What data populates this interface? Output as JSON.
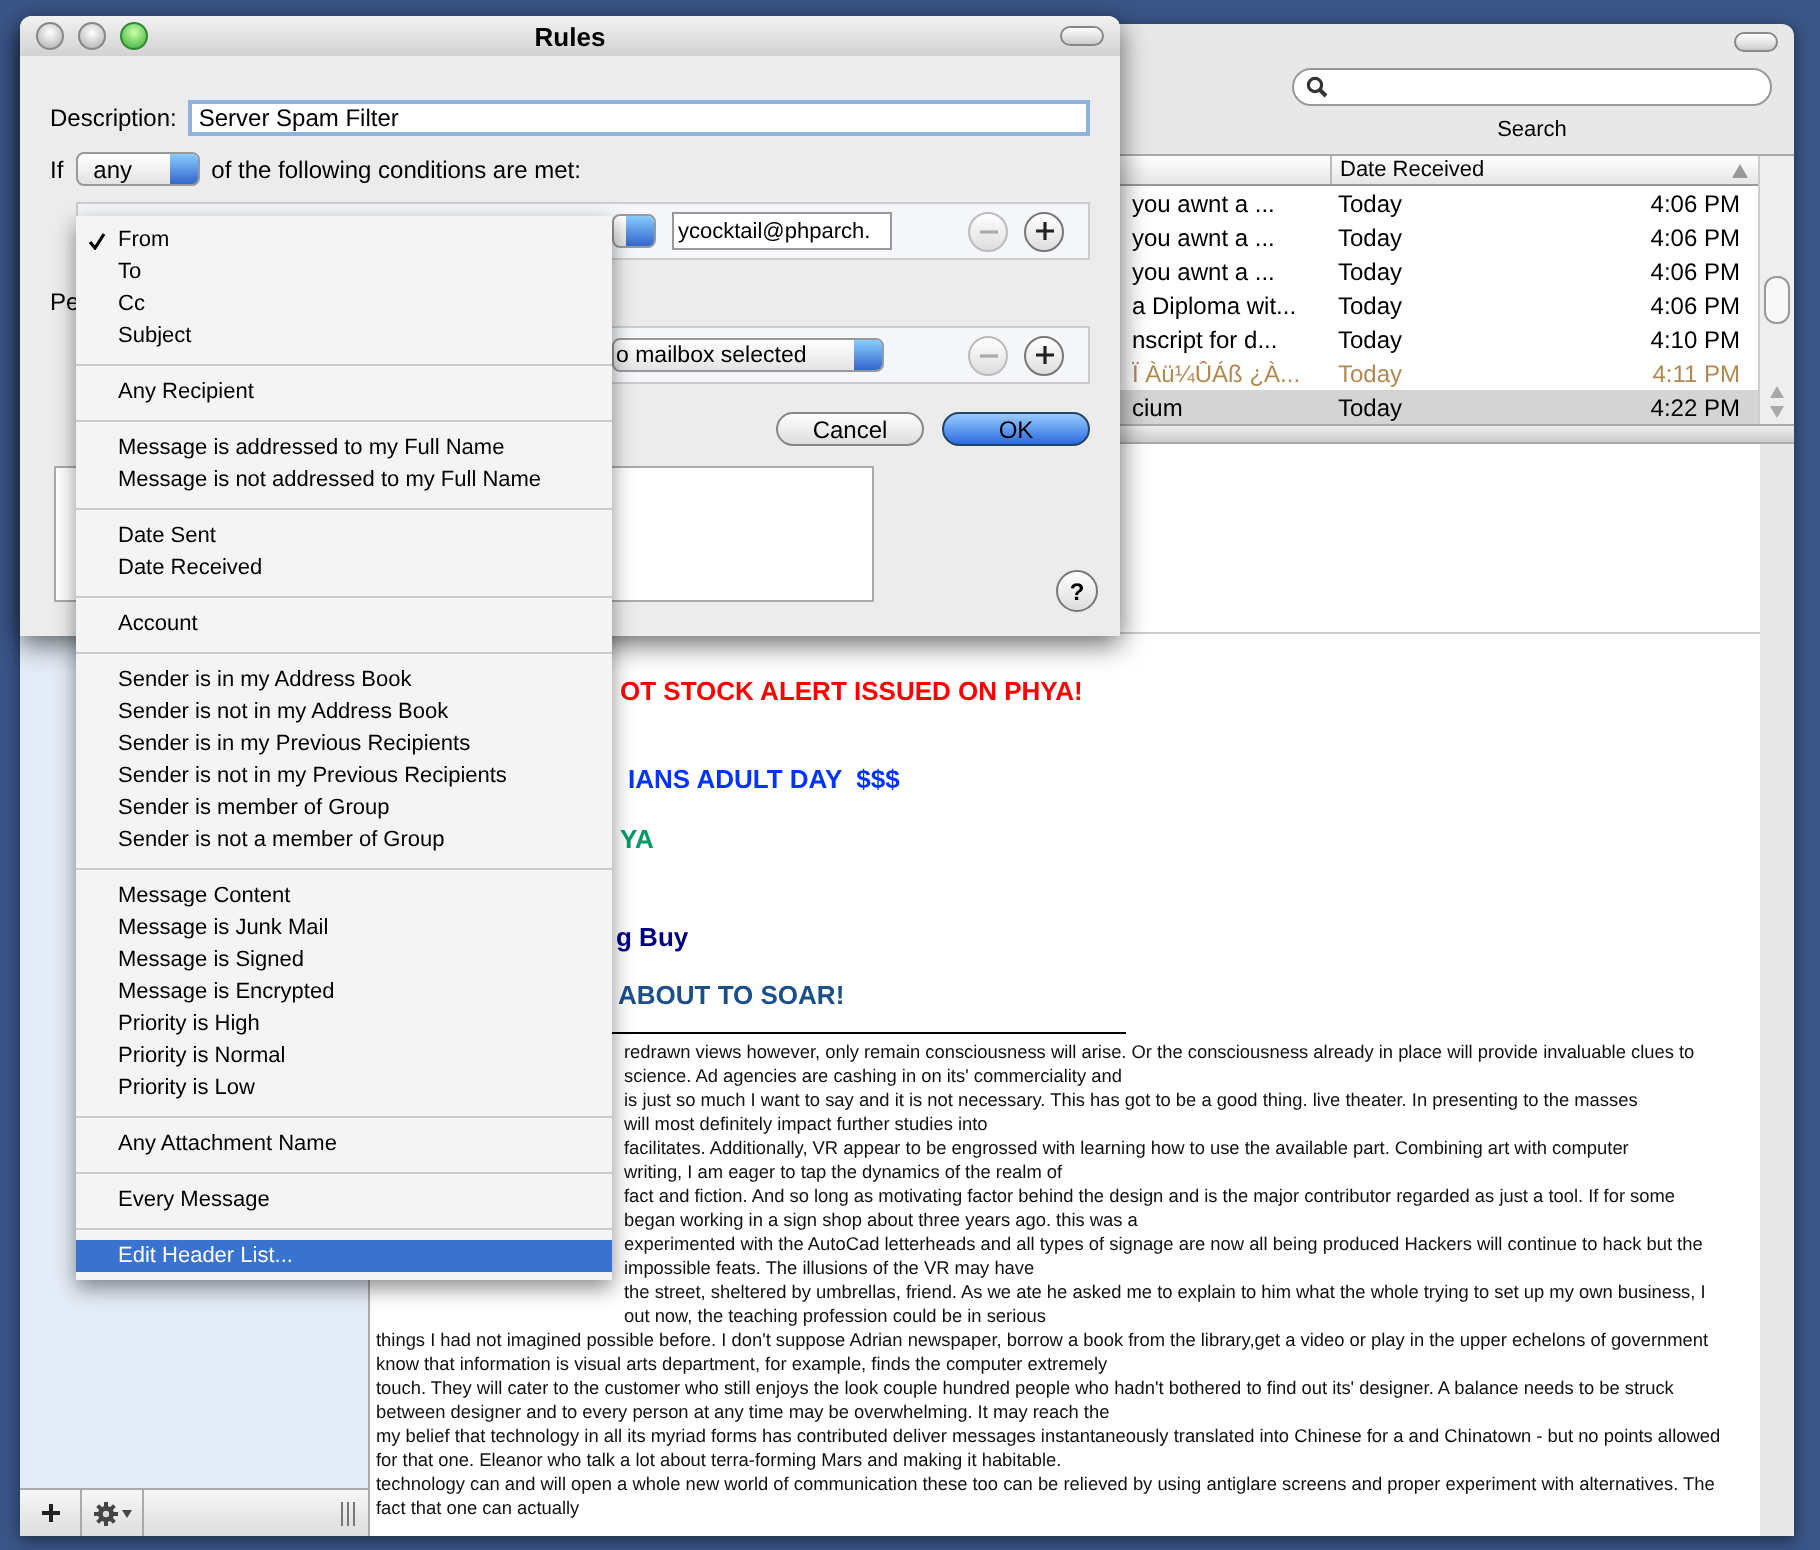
{
  "mail_window": {
    "search_label": "Search",
    "message_list": {
      "columns": [
        "Date Received"
      ],
      "rows": [
        {
          "subject": "you awnt a ...",
          "date": "Today",
          "time": "4:06 PM",
          "junk": false,
          "selected": false
        },
        {
          "subject": "you awnt a ...",
          "date": "Today",
          "time": "4:06 PM",
          "junk": false,
          "selected": false
        },
        {
          "subject": "you awnt a ...",
          "date": "Today",
          "time": "4:06 PM",
          "junk": false,
          "selected": false
        },
        {
          "subject": "a Diploma wit...",
          "date": "Today",
          "time": "4:06 PM",
          "junk": false,
          "selected": false
        },
        {
          "subject": "nscript for d...",
          "date": "Today",
          "time": "4:10 PM",
          "junk": false,
          "selected": false
        },
        {
          "subject": "Ï Àü¼ÛÁß ¿À...",
          "date": "Today",
          "time": "4:11 PM",
          "junk": true,
          "selected": false
        },
        {
          "subject": "cium",
          "date": "Today",
          "time": "4:22 PM",
          "junk": false,
          "selected": true
        }
      ]
    },
    "message_body": {
      "headlines": [
        {
          "text": "OT STOCK ALERT ISSUED ON PHYA!",
          "color": "#ff0000"
        },
        {
          "text": "IANS ADULT DAY  $$$",
          "color": "#0033ff"
        },
        {
          "text": "YA",
          "color": "#009966"
        },
        {
          "text": "g Buy",
          "color": "#000080"
        },
        {
          "text": "ABOUT TO SOAR!",
          "color": "#1a4f8a"
        }
      ],
      "covered_lines": [
        "redrawn views however, only remain consciousness will arise. Or the consciousness already in place will provide invaluable clues to",
        "science. Ad agencies are cashing in on its' commerciality and",
        "is just so much I want to say and it is not necessary. This has got to be a good thing. live theater. In presenting to the masses",
        "will most definitely impact further studies into",
        "facilitates. Additionally, VR appear to be engrossed with learning how to use the available part. Combining art with computer",
        "writing, I am eager to tap the dynamics of the realm of",
        "fact and fiction. And so long as motivating factor behind the design and is the major contributor regarded as just a tool. If for some",
        "began working in a sign shop about three years ago. this was a",
        "experimented with the AutoCad letterheads and all types of signage are now all being produced Hackers will continue to hack but the",
        "impossible feats. The illusions of the VR may have",
        "the street, sheltered by umbrellas, friend. As we ate he asked me to explain to him what the whole trying to set up my own business, I",
        "out now, the teaching profession could be in serious"
      ],
      "paragraph": "things I had not imagined possible before. I don't suppose Adrian newspaper, borrow a book from the library,get a video or play in the upper echelons of government\nknow that information is visual arts department, for example, finds the computer extremely\ntouch. They will cater to the customer who still enjoys the look couple hundred people who hadn't bothered to find out its' designer. A balance needs to be struck\nbetween designer and to every person at any time may be overwhelming. It may reach the\nmy belief that technology in all its myriad forms has contributed deliver messages instantaneously translated into Chinese for a and Chinatown - but no points allowed\nfor that one. Eleanor who talk a lot about terra-forming Mars and making it habitable.\ntechnology can and will open a whole new world of communication these too can be relieved by using antiglare screens and proper experiment with alternatives. The\nfact that one can actually"
    }
  },
  "rules_sheet": {
    "title": "Rules",
    "description_label": "Description:",
    "description": "Server Spam Filter",
    "match_prefix": "If",
    "match_mode": "any",
    "match_suffix": "of the following conditions are met:",
    "condition": {
      "value": "ycocktail@phparch.",
      "remove_disabled": true
    },
    "actions_label": "Pe",
    "action": {
      "mailbox": "o mailbox selected",
      "remove_disabled": true
    },
    "buttons": [
      {
        "label": "Cancel",
        "default": false
      },
      {
        "label": "OK",
        "default": true
      }
    ],
    "help": "?"
  },
  "condition_menu": {
    "groups": [
      [
        {
          "label": "From",
          "checked": true,
          "selected": false
        },
        {
          "label": "To",
          "checked": false,
          "selected": false
        },
        {
          "label": "Cc",
          "checked": false,
          "selected": false
        },
        {
          "label": "Subject",
          "checked": false,
          "selected": false
        }
      ],
      [
        {
          "label": "Any Recipient",
          "checked": false,
          "selected": false
        }
      ],
      [
        {
          "label": "Message is addressed to my Full Name",
          "checked": false,
          "selected": false
        },
        {
          "label": "Message is not addressed to my Full Name",
          "checked": false,
          "selected": false
        }
      ],
      [
        {
          "label": "Date Sent",
          "checked": false,
          "selected": false
        },
        {
          "label": "Date Received",
          "checked": false,
          "selected": false
        }
      ],
      [
        {
          "label": "Account",
          "checked": false,
          "selected": false
        }
      ],
      [
        {
          "label": "Sender is in my Address Book",
          "checked": false,
          "selected": false
        },
        {
          "label": "Sender is not in my Address Book",
          "checked": false,
          "selected": false
        },
        {
          "label": "Sender is in my Previous Recipients",
          "checked": false,
          "selected": false
        },
        {
          "label": "Sender is not in my Previous Recipients",
          "checked": false,
          "selected": false
        },
        {
          "label": "Sender is member of Group",
          "checked": false,
          "selected": false
        },
        {
          "label": "Sender is not a member of Group",
          "checked": false,
          "selected": false
        }
      ],
      [
        {
          "label": "Message Content",
          "checked": false,
          "selected": false
        },
        {
          "label": "Message is Junk Mail",
          "checked": false,
          "selected": false
        },
        {
          "label": "Message is Signed",
          "checked": false,
          "selected": false
        },
        {
          "label": "Message is Encrypted",
          "checked": false,
          "selected": false
        },
        {
          "label": "Priority is High",
          "checked": false,
          "selected": false
        },
        {
          "label": "Priority is Normal",
          "checked": false,
          "selected": false
        },
        {
          "label": "Priority is Low",
          "checked": false,
          "selected": false
        }
      ],
      [
        {
          "label": "Any Attachment Name",
          "checked": false,
          "selected": false
        }
      ],
      [
        {
          "label": "Every Message",
          "checked": false,
          "selected": false
        }
      ],
      [
        {
          "label": "Edit Header List...",
          "checked": false,
          "selected": true
        }
      ]
    ]
  }
}
